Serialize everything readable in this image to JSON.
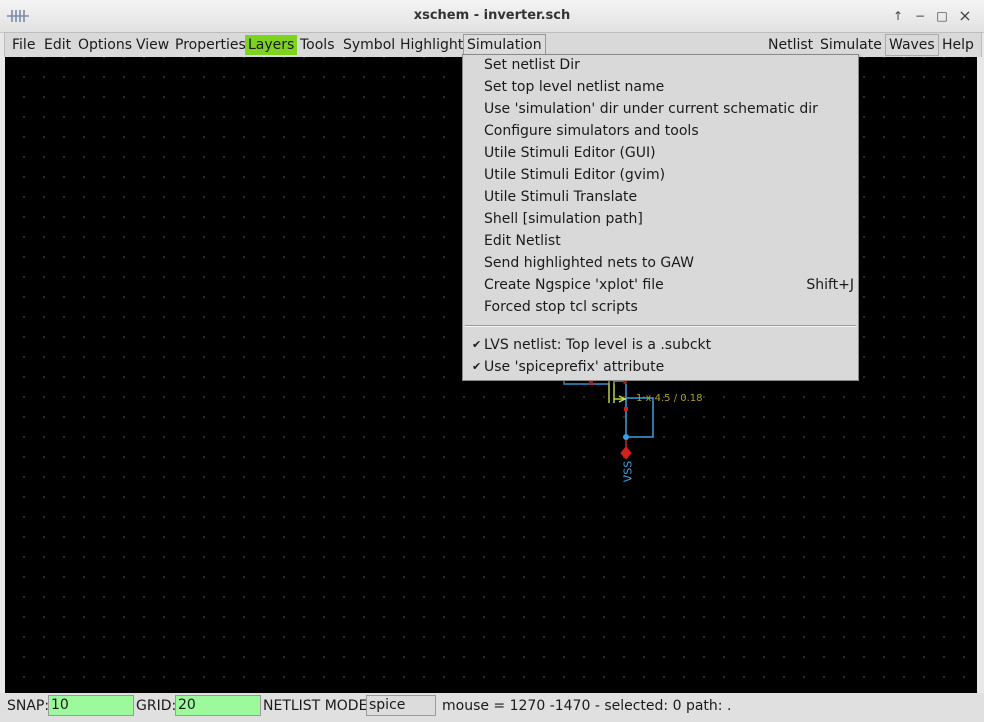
{
  "window": {
    "title": "xschem - inverter.sch"
  },
  "menubar": {
    "left": [
      "File",
      "Edit",
      "Options",
      "View",
      "Properties",
      "Layers",
      "Tools",
      "Symbol",
      "Highlight",
      "Simulation"
    ],
    "right": [
      "Netlist",
      "Simulate",
      "Waves",
      "Help"
    ],
    "active_color": "#7ed321"
  },
  "simulation_menu": {
    "items": [
      "Set netlist Dir",
      "Set top level netlist name",
      "Use 'simulation' dir under current schematic dir",
      "Configure simulators and tools",
      "Utile Stimuli Editor (GUI)",
      "Utile Stimuli Editor (gvim)",
      "Utile Stimuli Translate",
      "Shell [simulation path]",
      "Edit Netlist",
      "Send highlighted nets to GAW",
      "Create Ngspice 'xplot' file",
      "Forced stop tcl scripts"
    ],
    "xplot_accel": "Shift+J",
    "checks": [
      "LVS netlist: Top level is a .subckt",
      "Use 'spiceprefix' attribute"
    ]
  },
  "schematic": {
    "transistor_label": "1 x 4.5 / 0.18",
    "net_label": "VSS",
    "colors": {
      "wire": "#3aa0e6",
      "device": "#c8e04a",
      "pin": "#d02020",
      "label": "#b0a020"
    }
  },
  "statusbar": {
    "snap_label": "SNAP:",
    "snap_value": "10",
    "grid_label": "GRID:",
    "grid_value": "20",
    "mode_label": "NETLIST MODE:",
    "mode_value": "spice",
    "info": "mouse = 1270 -1470 - selected: 0 path: ."
  }
}
